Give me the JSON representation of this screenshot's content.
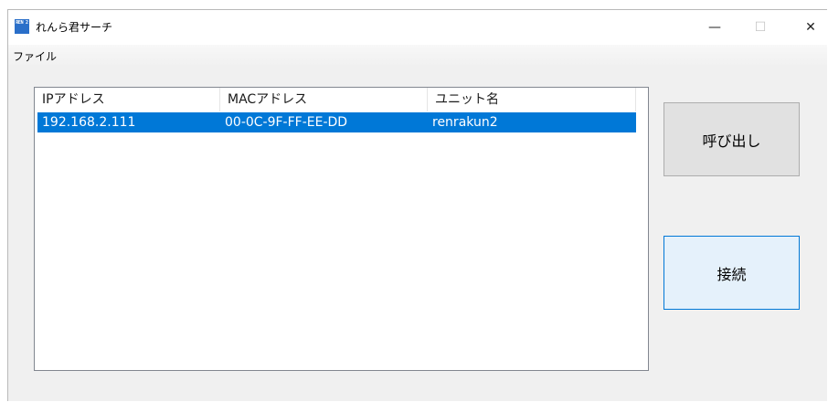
{
  "window": {
    "title": "れんら君サーチ",
    "icon_text": "REN 2",
    "controls": {
      "minimize": "—",
      "maximize": "☐",
      "close": "✕"
    }
  },
  "menu": {
    "file": "ファイル"
  },
  "list": {
    "columns": [
      "IPアドレス",
      "MACアドレス",
      "ユニット名"
    ],
    "rows": [
      {
        "ip": "192.168.2.111",
        "mac": "00-0C-9F-FF-EE-DD",
        "unit": "renrakun2",
        "selected": true
      }
    ]
  },
  "buttons": {
    "call": "呼び出し",
    "connect": "接続"
  },
  "colors": {
    "selection": "#0078d7",
    "default_button_border": "#0078d7",
    "default_button_bg": "#e5f1fb"
  }
}
